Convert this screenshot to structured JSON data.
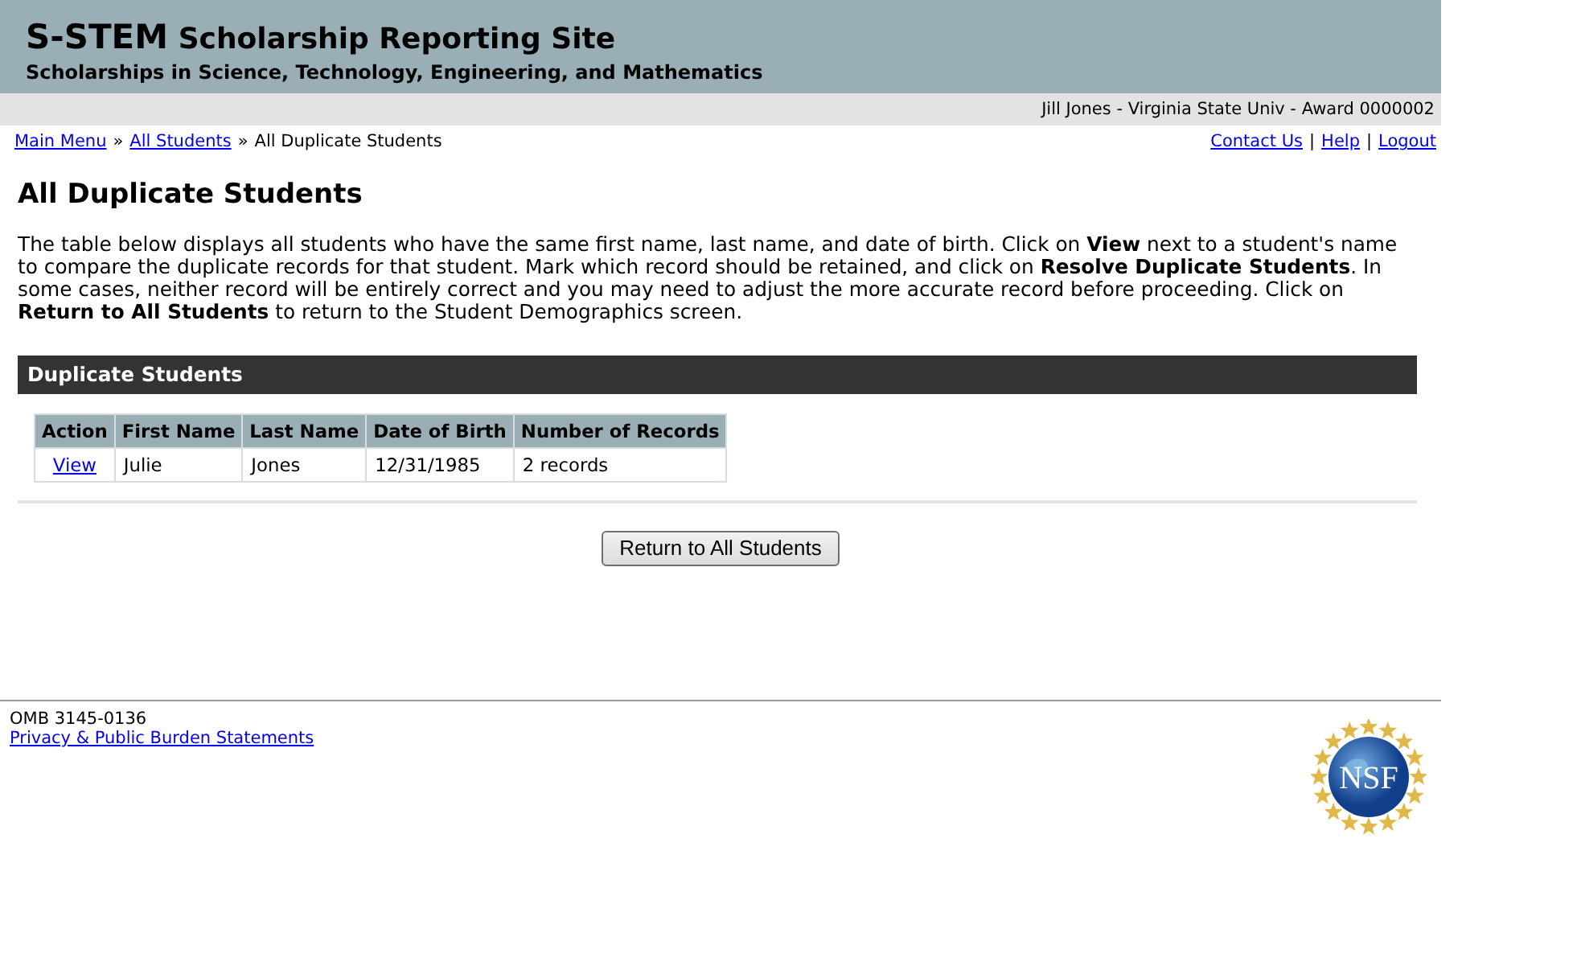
{
  "header": {
    "title_main": "S-STEM",
    "title_rest": "Scholarship Reporting Site",
    "subtitle": "Scholarships in Science, Technology, Engineering, and Mathematics"
  },
  "user_bar": "Jill Jones - Virginia State Univ - Award 0000002",
  "breadcrumbs": [
    {
      "label": "Main Menu",
      "link": true
    },
    {
      "label": "All Students",
      "link": true
    },
    {
      "label": "All Duplicate Students",
      "link": false
    }
  ],
  "breadcrumb_separator": "»",
  "top_links": [
    "Contact Us",
    "Help",
    "Logout"
  ],
  "link_separator": "|",
  "page_title": "All Duplicate Students",
  "intro": "The table below displays all students who have the same first name, last name, and date of birth. Click on **View** next to a student's name to compare the duplicate records for that student. Mark which record should be retained, and click on **Resolve Duplicate Students**. In some cases, neither record will be entirely correct and you may need to adjust the more accurate record before proceeding. Click on **Return to All Students** to return to the Student Demographics screen.",
  "section_title": "Duplicate Students",
  "table": {
    "columns": [
      "Action",
      "First Name",
      "Last Name",
      "Date of Birth",
      "Number of Records"
    ],
    "rows": [
      {
        "cells": [
          {
            "kind": "link",
            "text": "View"
          },
          {
            "kind": "text",
            "text": "Julie"
          },
          {
            "kind": "text",
            "text": "Jones"
          },
          {
            "kind": "text",
            "text": "12/31/1985"
          },
          {
            "kind": "text",
            "text": "2 records"
          }
        ]
      }
    ]
  },
  "button": "Return to All Students",
  "footer": {
    "omb": "OMB 3145-0136",
    "link": "Privacy & Public Burden Statements",
    "logo_text": "NSF"
  }
}
